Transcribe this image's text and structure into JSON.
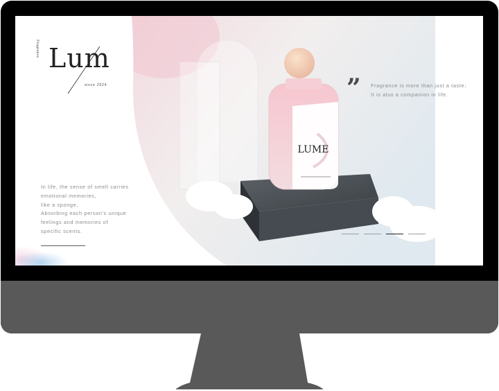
{
  "brand": {
    "logo_text": "Lume",
    "logo_vertical": "Fragrance",
    "since": "since 2024",
    "bottle_label": "LUME"
  },
  "quote": {
    "mark": "”",
    "lines": [
      "Fragrance is more than just a taste;",
      "It is also a companion in life."
    ]
  },
  "story": {
    "lines": [
      "In life, the sense of smell carries",
      "emotional memories,",
      "like a sponge,",
      "Absorbing each person's unique",
      "feelings and memories of",
      "specific scents."
    ]
  },
  "slider": {
    "count": 4,
    "active_index": 2
  },
  "colors": {
    "bezel": "#000000",
    "chin": "#595959",
    "accent_pink": "#f2c9cf",
    "text_gray": "#8b8b8b",
    "pedestal": "#3f4448"
  }
}
